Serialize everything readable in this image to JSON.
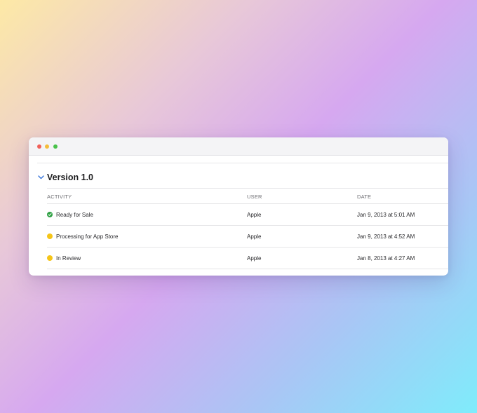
{
  "section": {
    "title": "Version 1.0",
    "expanded": true
  },
  "table": {
    "headers": {
      "activity": "ACTIVITY",
      "user": "USER",
      "date": "DATE"
    },
    "rows": [
      {
        "status": "ready",
        "status_color": "#2ea043",
        "activity": "Ready for Sale",
        "user": "Apple",
        "date": "Jan 9, 2013 at 5:01 AM"
      },
      {
        "status": "pending",
        "status_color": "#f5c518",
        "activity": "Processing for App Store",
        "user": "Apple",
        "date": "Jan 9, 2013 at 4:52 AM"
      },
      {
        "status": "pending",
        "status_color": "#f5c518",
        "activity": "In Review",
        "user": "Apple",
        "date": "Jan 8, 2013 at 4:27 AM"
      }
    ]
  },
  "icons": {
    "collapse": "chevron-down-icon",
    "ready": "checkmark-circle-icon",
    "pending": "yellow-dot-icon"
  },
  "colors": {
    "window_close": "#f0605a",
    "window_minimize": "#f5bd3b",
    "window_zoom": "#48c24a",
    "chevron": "#2f6fd8"
  }
}
